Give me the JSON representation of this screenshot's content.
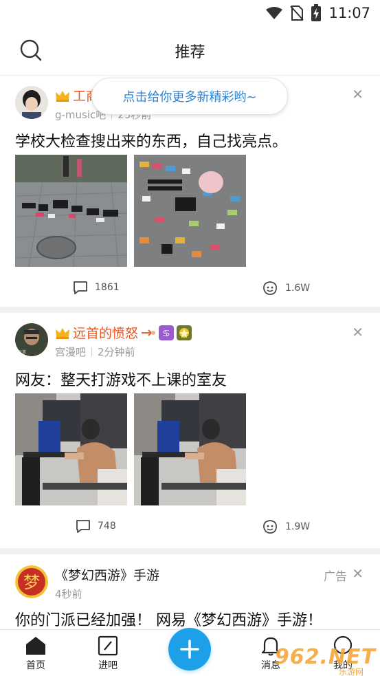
{
  "status_bar": {
    "time": "11:07"
  },
  "header": {
    "title": "推荐"
  },
  "tooltip": {
    "text": "点击给你更多新精彩哟~"
  },
  "posts": [
    {
      "username": "工商",
      "forum": "g-music吧",
      "time": "25秒前",
      "title": "学校大检查搜出来的东西，自己找亮点。",
      "comments": "1861",
      "likes": "1.6W"
    },
    {
      "username": "远首的愤怒",
      "forum": "宫漫吧",
      "time": "2分钟前",
      "title": "网友：整天打游戏不上课的室友",
      "comments": "748",
      "likes": "1.9W"
    },
    {
      "username": "《梦幻西游》手游",
      "time": "4秒前",
      "ad_label": "广告",
      "title": "你的门派已经加强！ 网易《梦幻西游》手游！"
    }
  ],
  "bottom_nav": {
    "home": "首页",
    "enter_bar": "进吧",
    "messages": "消息",
    "mine": "我的"
  },
  "watermark": {
    "text": "962.NET",
    "sub": "乐游网"
  },
  "colors": {
    "accent": "#1ea0e8",
    "username": "#e8541f",
    "tooltip_text": "#2d84d8"
  }
}
